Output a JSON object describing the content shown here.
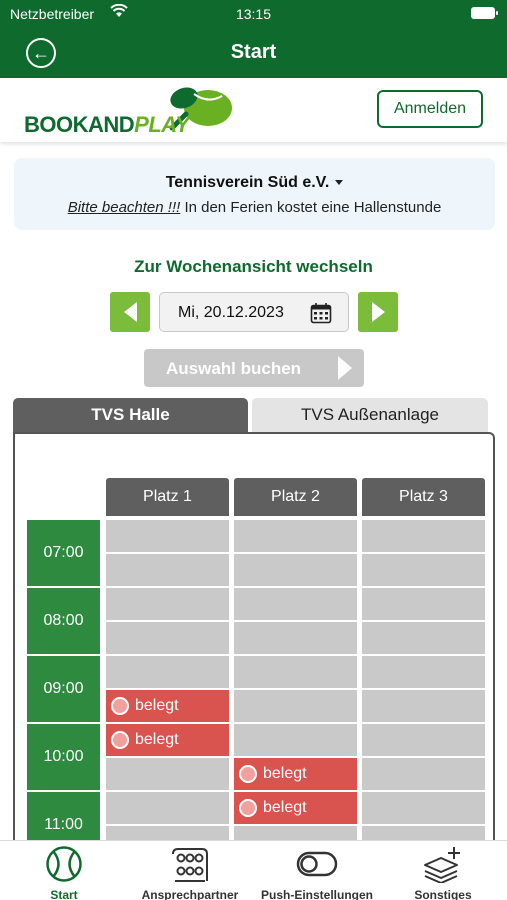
{
  "status_bar": {
    "carrier": "Netzbetreiber",
    "time": "13:15"
  },
  "nav": {
    "title": "Start",
    "back_icon": "back-arrow-icon"
  },
  "brand": {
    "logo_book": "BOOKAND",
    "logo_play": "PLAY",
    "login_label": "Anmelden",
    "color_primary": "#0f6a2e",
    "color_accent": "#6ab023"
  },
  "club": {
    "name": "Tennisverein Süd e.V.",
    "notice_emphasis": "Bitte beachten !!!",
    "notice_text": " In den Ferien kostet eine Hallenstunde"
  },
  "week_link": "Zur Wochenansicht wechseln",
  "date_picker": {
    "value": "Mi, 20.12.2023"
  },
  "book_button": "Auswahl buchen",
  "tabs": [
    {
      "label": "TVS Halle",
      "active": true
    },
    {
      "label": "TVS Außenanlage",
      "active": false
    }
  ],
  "schedule": {
    "courts": [
      "Platz 1",
      "Platz 2",
      "Platz 3"
    ],
    "hours": [
      "07:00",
      "08:00",
      "09:00",
      "10:00",
      "11:00"
    ],
    "booked_label": "belegt",
    "booked_slots": [
      {
        "court": 0,
        "start": "09:30"
      },
      {
        "court": 0,
        "start": "10:00"
      },
      {
        "court": 1,
        "start": "10:30"
      },
      {
        "court": 1,
        "start": "11:00"
      }
    ],
    "color_free": "#c9c9c9",
    "color_booked": "#d9534f",
    "color_hour": "#2d8a3e"
  },
  "bottom_tabs": [
    {
      "label": "Start",
      "icon": "tennis-ball-icon",
      "active": true
    },
    {
      "label": "Ansprechpartner",
      "icon": "people-icon",
      "active": false
    },
    {
      "label": "Push-Einstellungen",
      "icon": "toggle-icon",
      "active": false
    },
    {
      "label": "Sonstiges",
      "icon": "layers-plus-icon",
      "active": false
    }
  ]
}
